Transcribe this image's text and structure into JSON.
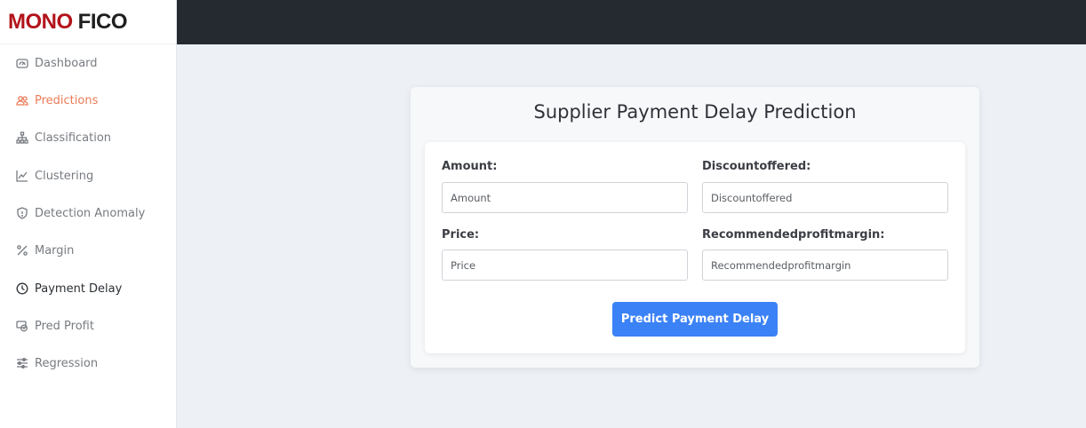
{
  "brand": {
    "part1": "MONO",
    "part2": "FICO",
    "color_part1": "#b3131b"
  },
  "sidebar": {
    "items": [
      {
        "label": "Dashboard",
        "icon": "gauge-icon"
      },
      {
        "label": "Predictions",
        "icon": "users-icon",
        "state": "highlighted"
      },
      {
        "label": "Classification",
        "icon": "hierarchy-icon"
      },
      {
        "label": "Clustering",
        "icon": "line-chart-icon"
      },
      {
        "label": "Detection Anomaly",
        "icon": "shield-icon"
      },
      {
        "label": "Margin",
        "icon": "percent-icon"
      },
      {
        "label": "Payment Delay",
        "icon": "clock-icon",
        "state": "current"
      },
      {
        "label": "Pred Profit",
        "icon": "money-icon"
      },
      {
        "label": "Regression",
        "icon": "sliders-icon"
      }
    ],
    "accent_color": "#ea7c57"
  },
  "form": {
    "title": "Supplier Payment Delay Prediction",
    "fields": [
      {
        "label": "Amount:",
        "placeholder": "Amount"
      },
      {
        "label": "Discountoffered:",
        "placeholder": "Discountoffered"
      },
      {
        "label": "Price:",
        "placeholder": "Price"
      },
      {
        "label": "Recommendedprofitmargin:",
        "placeholder": "Recommendedprofitmargin"
      }
    ],
    "submit_label": "Predict Payment Delay",
    "submit_color": "#3b82f6"
  }
}
